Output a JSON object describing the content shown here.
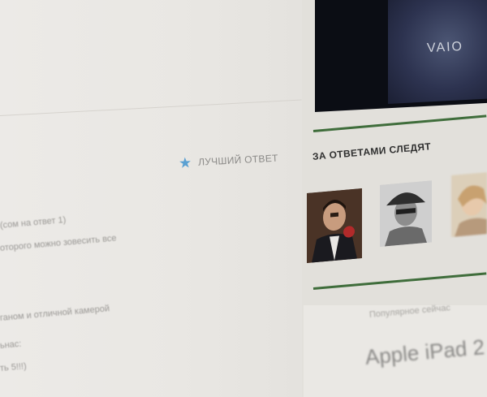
{
  "best_answer": {
    "label": "ЛУЧШИЙ ОТВЕТ",
    "icon": "star-icon",
    "color": "#5aa0d2"
  },
  "answer_text": {
    "lines": [
      "(сом на ответ 1)",
      "оторого можно зовесить все",
      "ганом и отличной камерой",
      "ьнас:",
      "ть 5!!!)"
    ]
  },
  "banner": {
    "logo_text": "VAIO"
  },
  "followers": {
    "title": "ЗА ОТВЕТАМИ СЛЕДЯТ",
    "items": [
      {
        "name": "follower-avatar-1"
      },
      {
        "name": "follower-avatar-2"
      },
      {
        "name": "follower-avatar-3"
      }
    ]
  },
  "promo": {
    "popular_label": "Популярное сейчас",
    "product_title": "Apple iPad 2"
  },
  "colors": {
    "accent_green": "#3f6d3b",
    "page_bg": "#e6e4e0"
  }
}
